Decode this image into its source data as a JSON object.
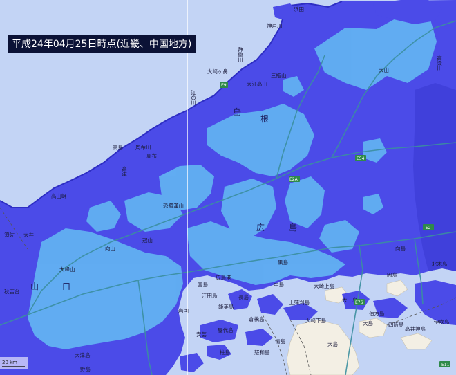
{
  "title": "平成24年04月25日時点(近畿、中国地方)",
  "colors": {
    "sea": "#c3d4f5",
    "land_base": "#4b4be8",
    "precip_light": "#62b1f2",
    "coast": "#3a3ad0",
    "road": "#3b8f9f",
    "island_land": "#f3efe4"
  },
  "prefecture_labels": [
    {
      "text": "島",
      "id": "shimane-a"
    },
    {
      "text": "根",
      "id": "shimane-b"
    },
    {
      "text": "広",
      "id": "hiroshima-a"
    },
    {
      "text": "島",
      "id": "hiroshima-b"
    },
    {
      "text": "山",
      "id": "yamaguchi-a"
    },
    {
      "text": "口",
      "id": "yamaguchi-b"
    }
  ],
  "place_labels": [
    "浜田",
    "神戸川",
    "静間川",
    "大崎ヶ鼻",
    "三瓶山",
    "大江高山",
    "江の川",
    "高島",
    "周布川",
    "周布",
    "高津",
    "高山岬",
    "須佐",
    "大井",
    "恐羅漢山",
    "冠山",
    "向山",
    "大峰山",
    "広島港",
    "黒島",
    "中島",
    "岩国",
    "長島",
    "屋代島",
    "上蒲刈島",
    "大崎下島",
    "大崎上島",
    "大三島",
    "伯方島",
    "大島",
    "四阪島",
    "高井神島",
    "伊吹島",
    "北木島",
    "因島",
    "向島",
    "倉橋島",
    "能美島",
    "江田島",
    "宮島",
    "柱島",
    "情島",
    "怒和島",
    "安芸",
    "大津島",
    "野島",
    "大島",
    "秋吉台",
    "高梁川",
    "大山"
  ],
  "road_badges": [
    "E54",
    "E2",
    "E76",
    "E11",
    "E9",
    "E2A"
  ],
  "scale": {
    "label": "20 km"
  }
}
